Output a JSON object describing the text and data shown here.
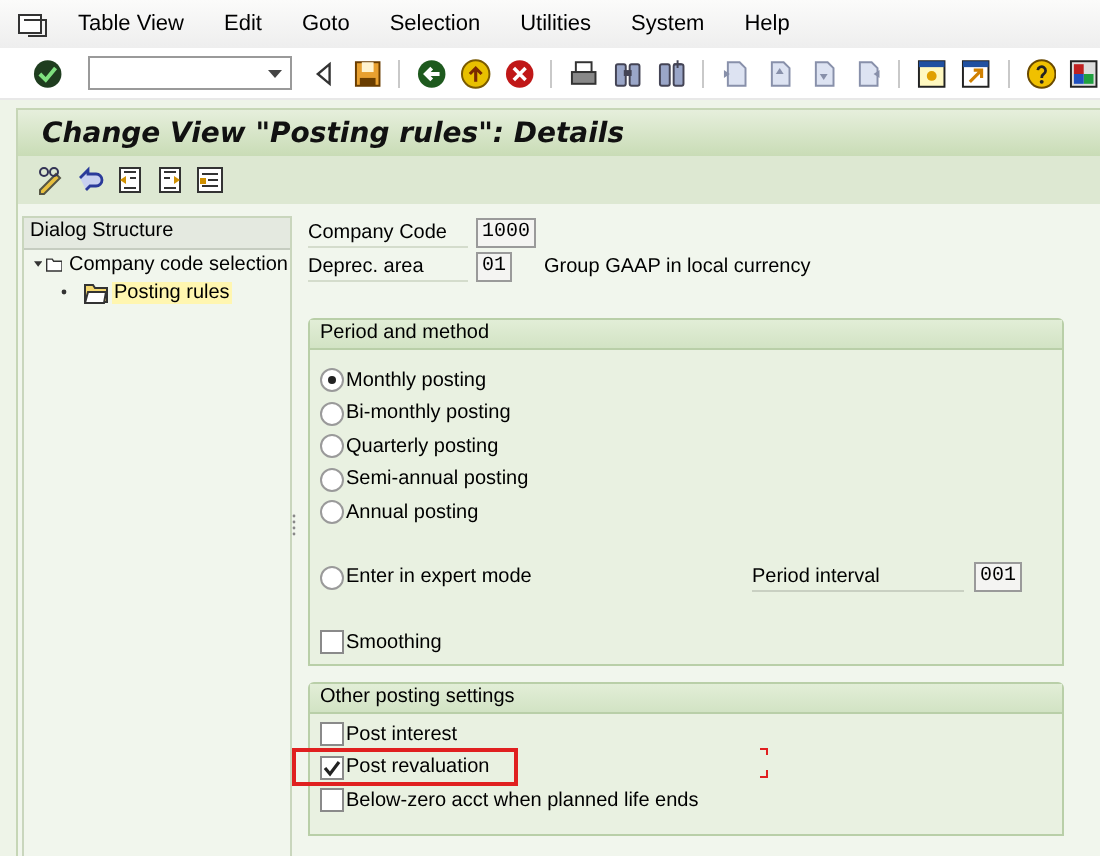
{
  "menu": {
    "items": [
      "Table View",
      "Edit",
      "Goto",
      "Selection",
      "Utilities",
      "System",
      "Help"
    ]
  },
  "title": "Change View \"Posting rules\": Details",
  "dialog_structure": {
    "title": "Dialog Structure",
    "tree": [
      {
        "label": "Company code selection",
        "expanded": true,
        "selected": false,
        "children": [
          {
            "label": "Posting rules",
            "selected": true
          }
        ]
      }
    ]
  },
  "header_fields": [
    {
      "label": "Company Code",
      "value": "1000"
    },
    {
      "label": "Deprec. area",
      "value": "01",
      "description": "Group GAAP in local currency"
    }
  ],
  "period_and_method": {
    "title": "Period and method",
    "options": [
      {
        "label": "Monthly posting",
        "selected": true
      },
      {
        "label": "Bi-monthly posting",
        "selected": false
      },
      {
        "label": "Quarterly posting",
        "selected": false
      },
      {
        "label": "Semi-annual posting",
        "selected": false
      },
      {
        "label": "Annual posting",
        "selected": false
      },
      {
        "label": "Enter in expert mode",
        "selected": false,
        "field": {
          "label": "Period interval",
          "value": "001"
        }
      }
    ],
    "smoothing": {
      "label": "Smoothing",
      "checked": false
    }
  },
  "other_posting_settings": {
    "title": "Other posting settings",
    "checkboxes": [
      {
        "label": "Post interest",
        "checked": false
      },
      {
        "label": "Post revaluation",
        "checked": true
      },
      {
        "label": "Below-zero acct when planned life ends",
        "checked": false
      }
    ]
  }
}
